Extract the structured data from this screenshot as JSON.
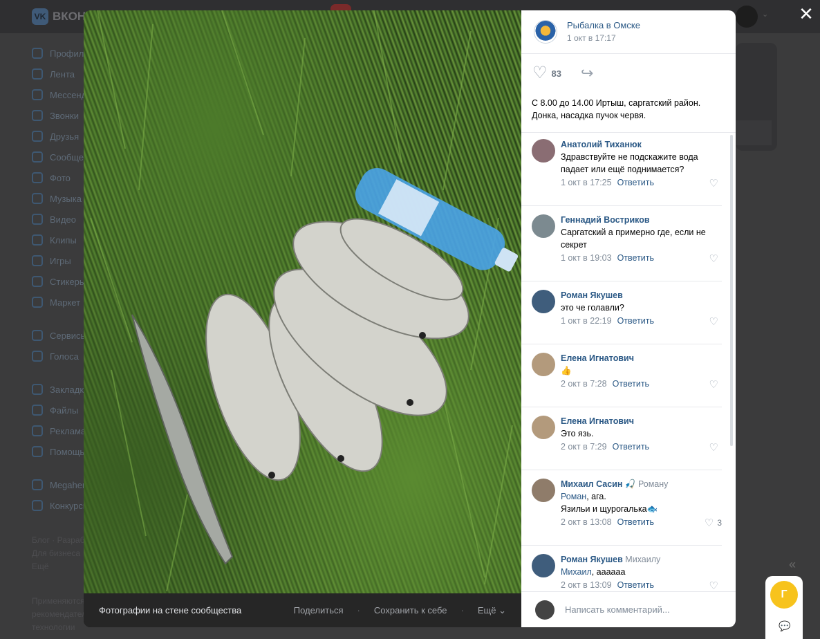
{
  "background": {
    "logo_text": "ВКОНТАКТЕ",
    "logo_mark": "VK",
    "nav": [
      "Профиль",
      "Лента",
      "Мессенджер",
      "Звонки",
      "Друзья",
      "Сообщества",
      "Фото",
      "Музыка",
      "Видео",
      "Клипы",
      "Игры",
      "Стикеры",
      "Маркет",
      "Сервисы",
      "Голоса",
      "Закладки",
      "Файлы",
      "Реклама",
      "Помощь",
      "Megahero",
      "Конкурсы"
    ],
    "footer_links": [
      "Блог · Разработчикам",
      "Для бизнеса",
      "Ещё"
    ],
    "footer_note": [
      "Применяются",
      "рекомендательные",
      "технологии"
    ]
  },
  "viewer": {
    "close_icon": "close-icon",
    "photo_caption": "Фотографии на стене сообщества",
    "actions": {
      "share": "Поделиться",
      "save": "Сохранить к себе",
      "more": "Ещё"
    },
    "community": {
      "name": "Рыбалка в Омске",
      "date": "1 окт в 17:17"
    },
    "likes": "83",
    "post_text": "С 8.00 до 14.00 Иртыш, саргатский район. Донка, насадка пучок червя.",
    "comments": [
      {
        "author": "Анатолий Тиханюк",
        "reply_to": "",
        "mention": "",
        "text": "Здравствуйте не подскажите вода падает или ещё поднимается?",
        "date": "1 окт в 17:25",
        "reply": "Ответить",
        "likes": "",
        "avatar_color": "#8a6d73"
      },
      {
        "author": "Геннадий Востриков",
        "reply_to": "",
        "mention": "",
        "text": "Саргатский а примерно где, если не секрет",
        "date": "1 окт в 19:03",
        "reply": "Ответить",
        "likes": "",
        "avatar_color": "#7c8a90"
      },
      {
        "author": "Роман Якушев",
        "reply_to": "",
        "mention": "",
        "text": "это че голавли?",
        "date": "1 окт в 22:19",
        "reply": "Ответить",
        "likes": "",
        "avatar_color": "#3f5d7c"
      },
      {
        "author": "Елена Игнатович",
        "reply_to": "",
        "mention": "",
        "text": "👍",
        "date": "2 окт в 7:28",
        "reply": "Ответить",
        "likes": "",
        "avatar_color": "#b39a7c"
      },
      {
        "author": "Елена Игнатович",
        "reply_to": "",
        "mention": "",
        "text": "Это язь.",
        "date": "2 окт в 7:29",
        "reply": "Ответить",
        "likes": "",
        "avatar_color": "#b39a7c"
      },
      {
        "author": "Михаил Сасин 🎣",
        "reply_to": "Роману",
        "mention": "Роман",
        "text": ", ага.\nЯзильи и щурогалька🐟",
        "date": "2 окт в 13:08",
        "reply": "Ответить",
        "likes": "3",
        "avatar_color": "#8f7c6a"
      },
      {
        "author": "Роман Якушев",
        "reply_to": "Михаилу",
        "mention": "Михаил",
        "text": ", аааааа",
        "date": "2 окт в 13:09",
        "reply": "Ответить",
        "likes": "",
        "avatar_color": "#3f5d7c"
      }
    ],
    "composer_placeholder": "Написать комментарий..."
  },
  "fab": {
    "initial": "Г"
  },
  "colors": {
    "link": "#2a5885",
    "muted": "#818c99",
    "accent": "#f7c31d"
  }
}
